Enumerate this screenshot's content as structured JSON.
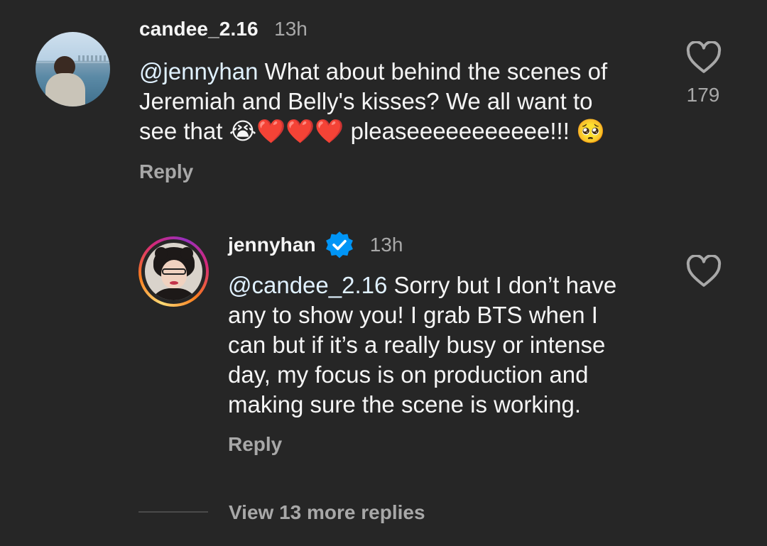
{
  "comments": [
    {
      "username": "candee_2.16",
      "time": "13h",
      "mention": "@jennyhan",
      "text_line1": " What about behind the scenes of",
      "text_line2": "Jeremiah and Belly's kisses? We all want to",
      "text_line3_a": "see that ",
      "emoji_cry": "😭",
      "emoji_hearts": "❤️❤️❤️",
      "text_line3_b": " pleaseeeeeeeeeee!!! ",
      "emoji_pleading": "🥺",
      "like_count": "179",
      "reply_label": "Reply",
      "avatar_icon": "profile-photo"
    }
  ],
  "reply": {
    "username": "jennyhan",
    "verified_icon": "verified-badge-icon",
    "time": "13h",
    "mention": "@candee_2.16",
    "lines": [
      " Sorry but I don’t have",
      "any to show you! I grab BTS when I",
      "can but if it’s a really busy or intense",
      "day, my focus is on production and",
      "making sure the scene is working."
    ],
    "reply_label": "Reply",
    "avatar_icon": "profile-photo-story-ring"
  },
  "view_more_replies": "View 13 more replies",
  "colors": {
    "background": "#262626",
    "primary_text": "#f5f5f5",
    "secondary_text": "#a8a8a8",
    "mention": "#e0f1ff",
    "verified_blue": "#0095f6"
  }
}
